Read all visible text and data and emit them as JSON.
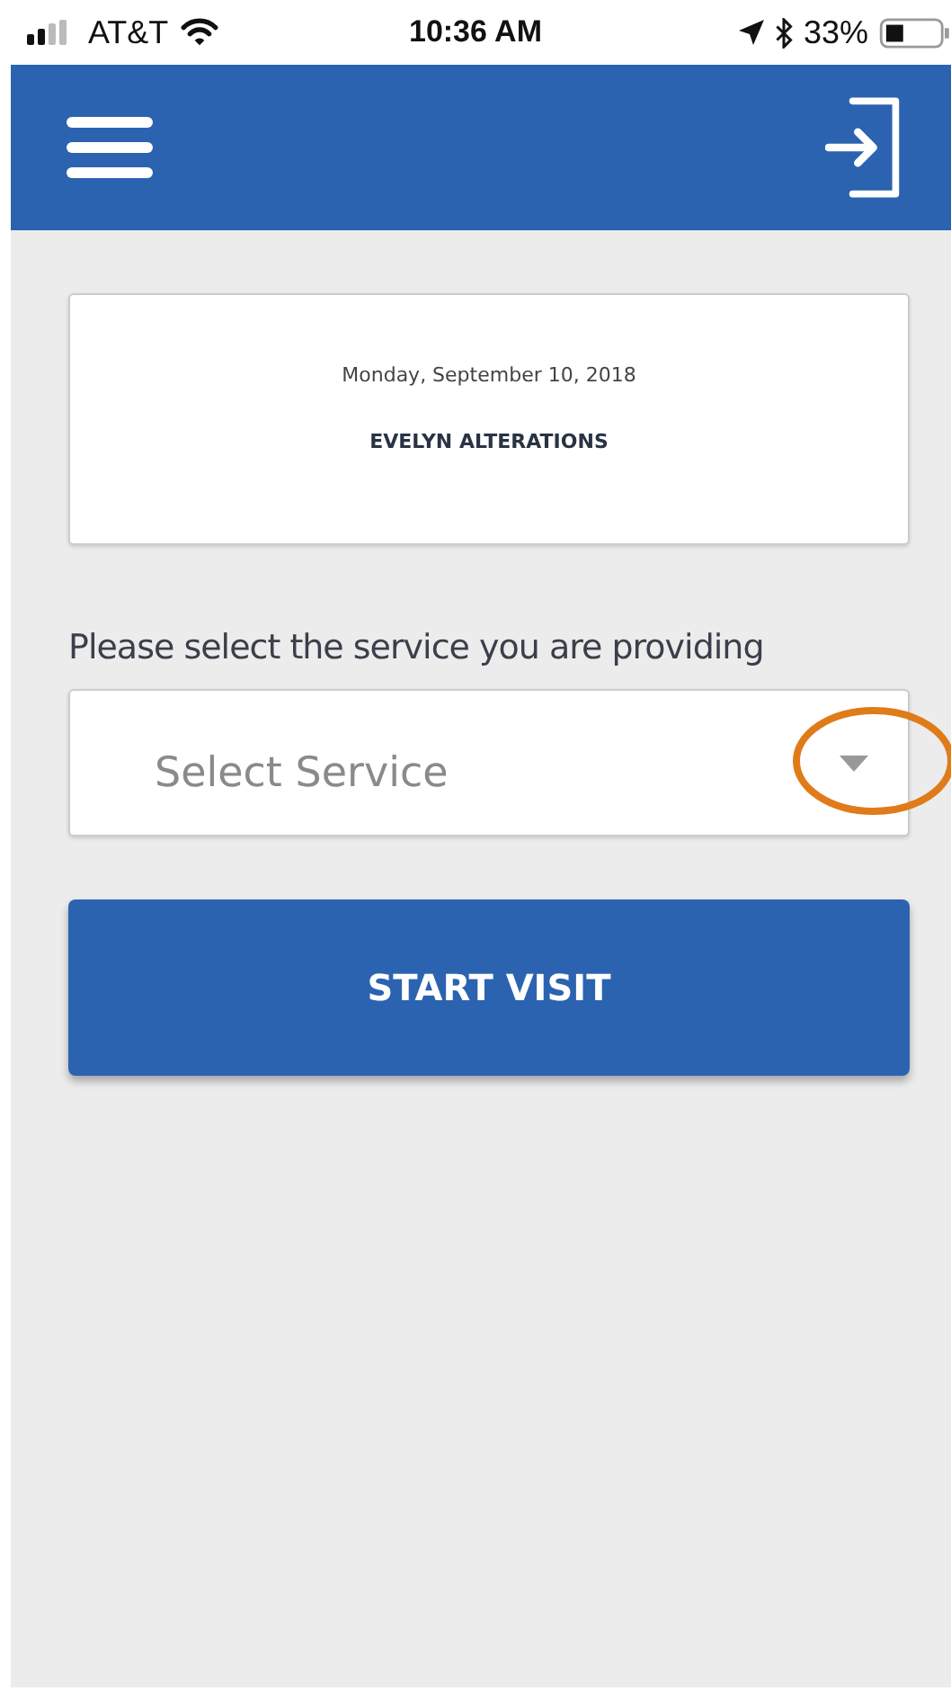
{
  "status_bar": {
    "carrier": "AT&T",
    "time": "10:36 AM",
    "battery": "33%"
  },
  "visit_card": {
    "date": "Monday, September 10, 2018",
    "client": "EVELYN ALTERATIONS"
  },
  "service_prompt": "Please select the service you are providing",
  "service_select": {
    "placeholder": "Select Service"
  },
  "start_button": "START VISIT"
}
